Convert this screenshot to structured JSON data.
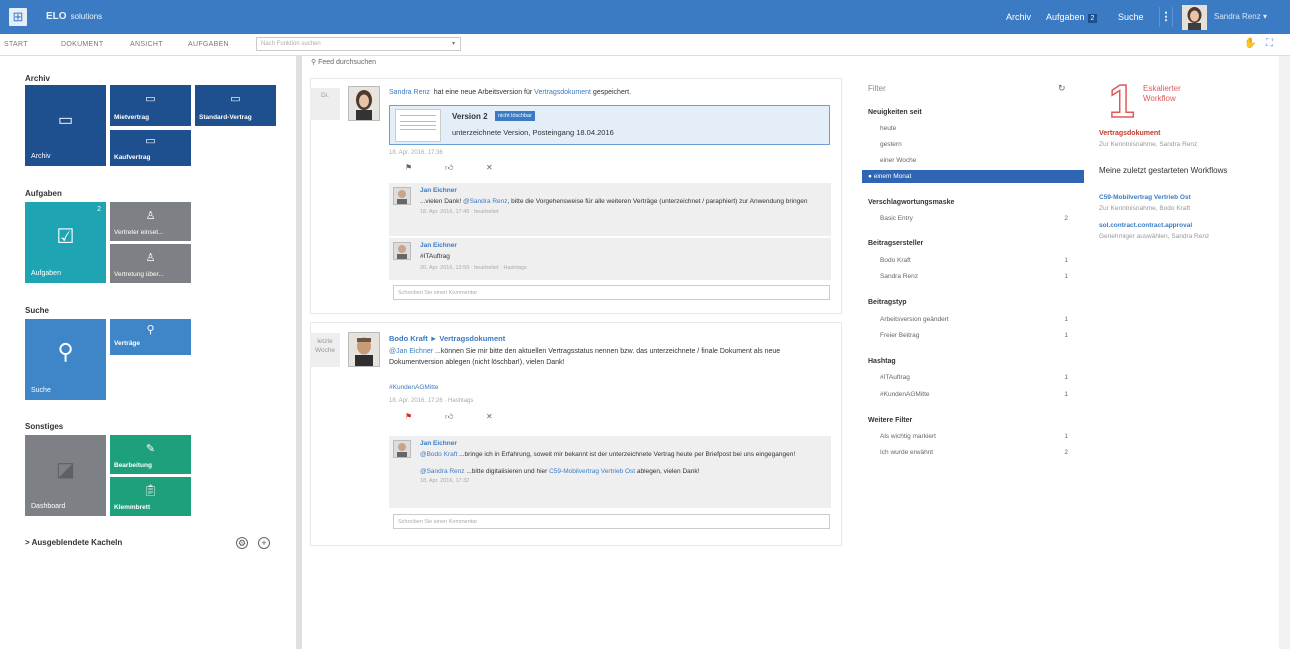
{
  "header": {
    "brand": "ELO",
    "brand_sub": "solutions",
    "nav": [
      {
        "label": "Archiv"
      },
      {
        "label": "Aufgaben",
        "badge": "2"
      },
      {
        "label": "Suche"
      }
    ],
    "user": "Sandra Renz",
    "user_caret": "▾",
    "menu_glyph": "⋮"
  },
  "menubar": {
    "items": [
      "START",
      "DOKUMENT",
      "ANSICHT",
      "AUFGABEN"
    ],
    "search_placeholder": "Nach Funktion suchen",
    "search_caret": "▾"
  },
  "left": {
    "sections": {
      "archiv": "Archiv",
      "aufgaben": "Aufgaben",
      "suche": "Suche",
      "sonstiges": "Sonstiges"
    },
    "tiles": {
      "archiv": "Archiv",
      "mietvertrag": "Mietvertrag",
      "standard": "Standard-Vertrag",
      "kaufvertrag": "Kaufvertrag",
      "aufgaben": "Aufgaben",
      "aufgaben_badge": "2",
      "vertreter": "Vertreter einset...",
      "vertretung": "Vertretung über...",
      "suche": "Suche",
      "vertraege": "Verträge",
      "dashboard": "Dashboard",
      "bearbeitung": "Bearbeitung",
      "klemmbrett": "Klemmbrett"
    },
    "hidden_tiles": "> Ausgeblendete Kacheln"
  },
  "feed": {
    "search_placeholder": "Feed durchsuchen",
    "post1": {
      "date_group": "Di.",
      "author": "Sandra Renz",
      "text": "hat eine neue Arbeitsversion für",
      "doc": "Vertragsdokument",
      "text2": "gespeichert.",
      "version": "Version 2",
      "version_badge": "nicht löschbar",
      "version_desc": "unterzeichnete Version, Posteingang 18.04.2016",
      "meta": "18. Apr. 2016, 17:36",
      "comments": [
        {
          "author": "Jan Eichner",
          "pre": "...vielen Dank!",
          "mention": "@Sandra Renz",
          "text": ", bitte die Vorgehensweise für alle weiteren Verträge (unterzeichnet / paraphiert) zur Anwendung bringen",
          "meta": "18. Apr. 2016, 17:49 · bearbeitet"
        },
        {
          "author": "Jan Eichner",
          "tag": "#ITAuftrag",
          "meta": "20. Apr. 2016, 13:59 · bearbeitet · Hashtags"
        }
      ],
      "comment_placeholder": "Schreiben Sie einen Kommentar"
    },
    "post2": {
      "date_group": "letzte Woche",
      "author": "Bodo Kraft",
      "arrow": "►",
      "doc": "Vertragsdokument",
      "mention": "@Jan Eichner",
      "text": "...können Sie mir bitte den aktuellen Vertragsstatus nennen bzw. das unterzeichnete / finale Dokument als neue Dokumentversion ablegen (nicht löschbar!), vielen Dank!",
      "tag": "#KundenAGMitte",
      "meta": "18. Apr. 2016, 17:26 · Hashtags",
      "comment": {
        "author": "Jan Eichner",
        "mention1": "@Bodo Kraft",
        "text1": "...bringe ich in Erfahrung, soweit mir bekannt ist der unterzeichnete Vertrag heute per Briefpost bei uns eingegangen!",
        "mention2": "@Sandra Renz",
        "text2": "...bitte digitalisieren und hier",
        "link": "C59-Mobilvertrag Vertrieb Ost",
        "text3": "ablegen, vielen Dank!",
        "meta": "18. Apr. 2016, 17:32"
      },
      "comment_placeholder": "Schreiben Sie einen Kommentar"
    }
  },
  "filter": {
    "title": "Filter",
    "groups": [
      {
        "title": "Neuigkeiten seit",
        "items": [
          {
            "label": "heute"
          },
          {
            "label": "gestern"
          },
          {
            "label": "einer Woche"
          },
          {
            "label": "einem Monat",
            "selected": true
          }
        ]
      },
      {
        "title": "Verschlagwortungsmaske",
        "items": [
          {
            "label": "Basic Entry",
            "count": "2"
          }
        ]
      },
      {
        "title": "Beitragsersteller",
        "items": [
          {
            "label": "Bodo Kraft",
            "count": "1"
          },
          {
            "label": "Sandra Renz",
            "count": "1"
          }
        ]
      },
      {
        "title": "Beitragstyp",
        "items": [
          {
            "label": "Arbeitsversion geändert",
            "count": "1"
          },
          {
            "label": "Freier Beitrag",
            "count": "1"
          }
        ]
      },
      {
        "title": "Hashtag",
        "items": [
          {
            "label": "#ITAuftrag",
            "count": "1"
          },
          {
            "label": "#KundenAGMitte",
            "count": "1"
          }
        ]
      },
      {
        "title": "Weitere Filter",
        "items": [
          {
            "label": "Als wichtig markiert",
            "count": "1"
          },
          {
            "label": "Ich wurde erwähnt",
            "count": "2"
          }
        ]
      }
    ]
  },
  "right": {
    "escalated_count": "1",
    "escalated_label": "Eskalierter Workflow",
    "doc_title": "Vertragsdokument",
    "doc_sub": "Zur Kenntnisnahme, Sandra Renz",
    "started_title": "Meine zuletzt gestarteten Workflows",
    "workflows": [
      {
        "title": "C59-Mobilvertrag Vertrieb Ost",
        "sub": "Zur Kenntnisnahme, Bodo Kraft"
      },
      {
        "title": "sol.contract.contract.approval",
        "sub": "Genehmiger auswählen, Sandra Renz"
      }
    ]
  },
  "colors": {
    "brand": "#3a7bc4",
    "tile_blue_dark": "#1e4f8f",
    "tile_blue": "#3f86c9",
    "tile_teal": "#1ea4b2",
    "tile_gray": "#7d8185",
    "tile_green": "#1fa07d",
    "escalated": "#e05a5a"
  }
}
